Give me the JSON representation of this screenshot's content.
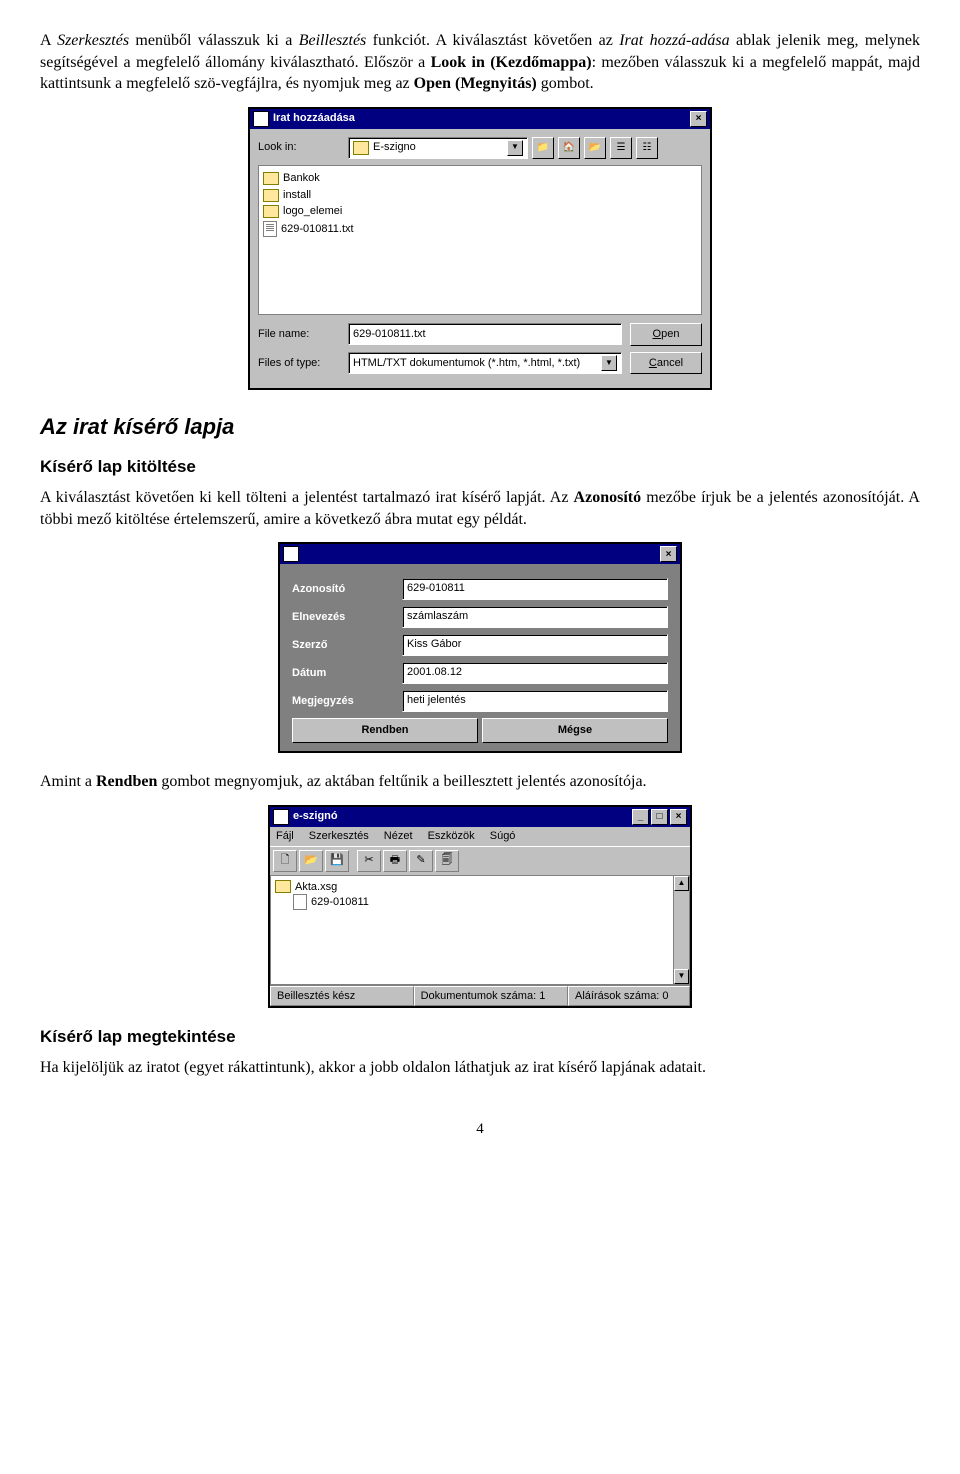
{
  "para1_a": "A ",
  "para1_b": "Szerkesztés",
  "para1_c": " menüből válasszuk ki a ",
  "para1_d": "Beillesztés",
  "para1_e": " funkciót. A kiválasztást követően az ",
  "para1_f": "Irat hozzá-adása",
  "para1_g": " ablak jelenik meg, melynek segítségével a megfelelő állomány kiválasztható. Először a ",
  "para1_h": "Look in (Kezdőmappa)",
  "para1_i": ": mezőben válasszuk ki a megfelelő mappát, majd kattintsunk a megfelelő szö-vegfájlra, és nyomjuk meg az ",
  "para1_j": "Open (Megnyitás)",
  "para1_k": " gombot.",
  "dlg1": {
    "title": "Irat hozzáadása",
    "lookin_lbl": "Look in:",
    "lookin_val": "E-szigno",
    "files": [
      "Bankok",
      "install",
      "logo_elemei"
    ],
    "file_txt": "629-010811.txt",
    "fname_lbl": "File name:",
    "fname_val": "629-010811.txt",
    "ftype_lbl": "Files of type:",
    "ftype_val": "HTML/TXT dokumentumok (*.htm, *.html, *.txt)",
    "open": "Open",
    "cancel": "Cancel"
  },
  "h2a": "Az irat kísérő lapja",
  "h3a": "Kísérő lap kitöltése",
  "para2_a": "A kiválasztást követően ki kell tölteni a jelentést tartalmazó irat kísérő lapját. Az ",
  "para2_b": "Azonosító",
  "para2_c": " mezőbe írjuk be a jelentés azonosítóját. A többi mező kitöltése értelemszerű, amire a következő ábra mutat egy példát.",
  "dlg2": {
    "f": [
      {
        "l": "Azonosító",
        "v": "629-010811"
      },
      {
        "l": "Elnevezés",
        "v": "számlaszám"
      },
      {
        "l": "Szerző",
        "v": "Kiss Gábor"
      },
      {
        "l": "Dátum",
        "v": "2001.08.12"
      },
      {
        "l": "Megjegyzés",
        "v": "heti jelentés"
      }
    ],
    "ok": "Rendben",
    "cancel": "Mégse"
  },
  "para3_a": "Amint a ",
  "para3_b": "Rendben",
  "para3_c": " gombot megnyomjuk, az aktában feltűnik a beillesztett jelentés azonosítója.",
  "dlg3": {
    "title": "e-szignó",
    "menu": [
      "Fájl",
      "Szerkesztés",
      "Nézet",
      "Eszközök",
      "Súgó"
    ],
    "tree_root": "Akta.xsg",
    "tree_child": "629-010811",
    "status": [
      "Beillesztés kész",
      "Dokumentumok száma: 1",
      "Aláírások száma: 0"
    ]
  },
  "h3b": "Kísérő lap megtekintése",
  "para4": "Ha kijelöljük az iratot (egyet rákattintunk), akkor a jobb oldalon láthatjuk az irat kísérő lapjának adatait.",
  "pagenum": "4"
}
